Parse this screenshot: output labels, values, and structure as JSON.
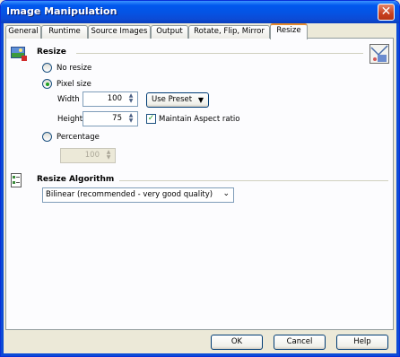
{
  "window": {
    "title": "Image Manipulation",
    "close_glyph": "✕"
  },
  "tabs": [
    {
      "label": "General"
    },
    {
      "label": "Runtime"
    },
    {
      "label": "Source Images"
    },
    {
      "label": "Output"
    },
    {
      "label": "Rotate, Flip, Mirror"
    },
    {
      "label": "Resize",
      "active": true
    }
  ],
  "resize": {
    "section_title": "Resize",
    "icon": "image-resize-icon",
    "corner_icon": "image-preview-icon",
    "no_resize_label": "No resize",
    "pixel_size_label": "Pixel size",
    "selected_option": "Pixel size",
    "width_label": "Width",
    "width_value": "100",
    "height_label": "Height",
    "height_value": "75",
    "preset_button": "Use Preset",
    "maintain_aspect_label": "Maintain Aspect ratio",
    "maintain_aspect_checked": true,
    "percentage_label": "Percentage",
    "percentage_value": "100"
  },
  "algorithm": {
    "section_title": "Resize Algorithm",
    "icon": "list-checklist-icon",
    "selected": "Bilinear (recommended - very good quality)"
  },
  "buttons": {
    "ok": "OK",
    "cancel": "Cancel",
    "help": "Help"
  }
}
